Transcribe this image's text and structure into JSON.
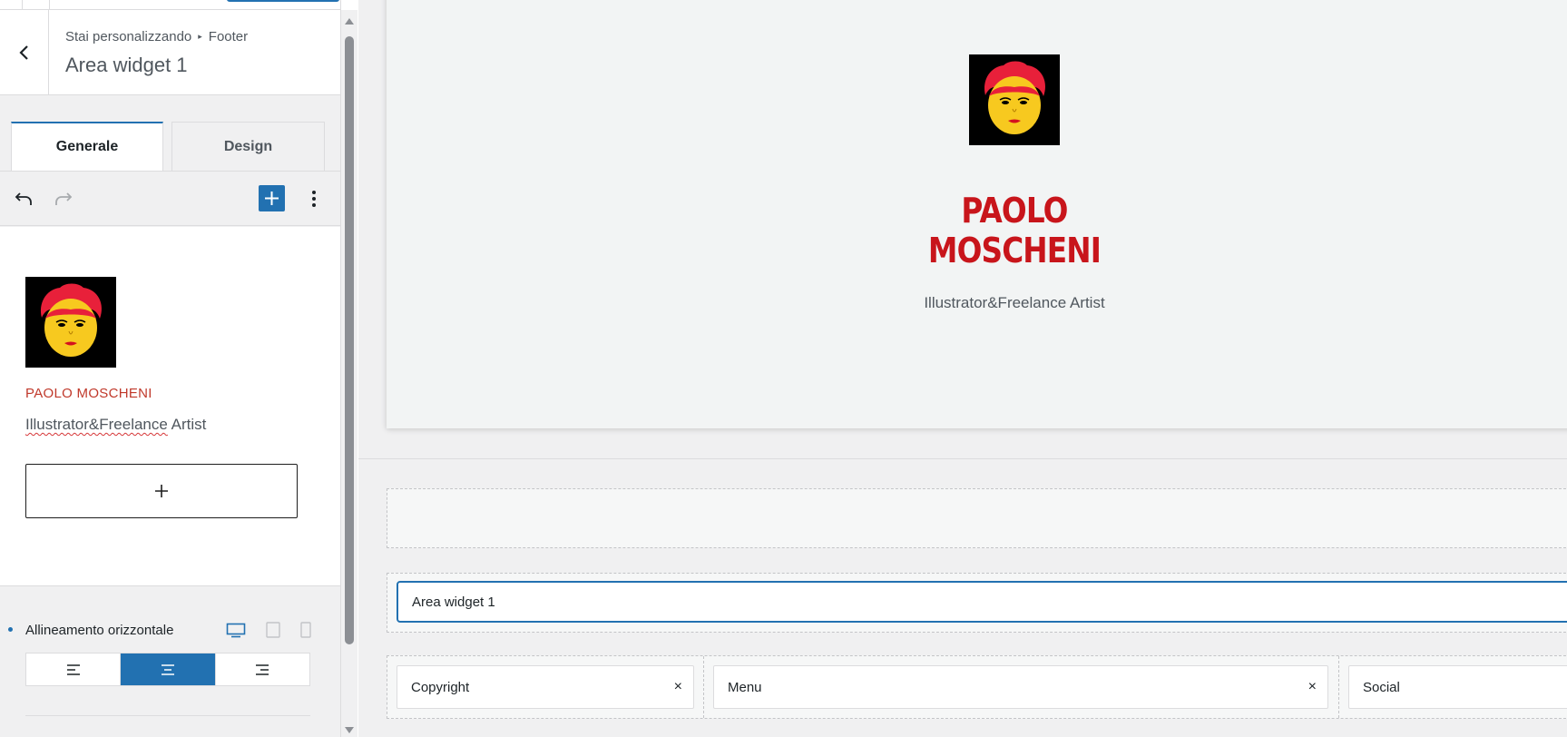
{
  "sidebar": {
    "breadcrumb": {
      "prefix": "Stai personalizzando",
      "section": "Footer"
    },
    "title": "Area widget 1",
    "tabs": [
      {
        "label": "Generale"
      },
      {
        "label": "Design"
      }
    ],
    "editor": {
      "name": "PAOLO MOSCHENI",
      "subtitle_part1": "Illustrator&Freelance",
      "subtitle_part2": " Artist"
    },
    "options": {
      "label": "Allineamento orizzontale",
      "alignment_selected": "center"
    }
  },
  "preview": {
    "name": "PAOLO MOSCHENI",
    "subtitle": "Illustrator&Freelance Artist"
  },
  "footer_builder": {
    "row2_item": "Area widget 1",
    "row3_items": [
      {
        "label": "Copyright",
        "remove": "×"
      },
      {
        "label": "Menu",
        "remove": "×"
      },
      {
        "label": "Social"
      }
    ]
  },
  "colors": {
    "accent": "#2271b1",
    "brand_red": "#c8151b",
    "portrait_hair": "#e8203a",
    "portrait_face": "#f7c91f"
  },
  "icons": [
    "back-arrow-icon",
    "undo-icon",
    "redo-icon",
    "plus-icon",
    "more-vertical-icon",
    "desktop-icon",
    "tablet-icon",
    "mobile-icon",
    "align-left-icon",
    "align-center-icon",
    "align-right-icon",
    "close-icon"
  ]
}
